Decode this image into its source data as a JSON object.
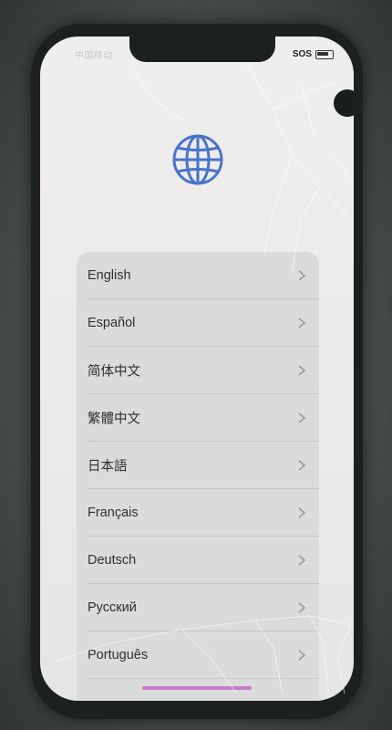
{
  "status_bar": {
    "carrier": "中国移动",
    "sos_label": "SOS"
  },
  "header": {
    "icon": "globe-icon",
    "accent_color": "#4a74c9"
  },
  "language_list": {
    "items": [
      {
        "label": "English"
      },
      {
        "label": "Español"
      },
      {
        "label": "简体中文"
      },
      {
        "label": "繁體中文"
      },
      {
        "label": "日本語"
      },
      {
        "label": "Français"
      },
      {
        "label": "Deutsch"
      },
      {
        "label": "Русский"
      },
      {
        "label": "Português"
      }
    ],
    "chevron_icon": "chevron-right-icon"
  },
  "home_indicator_color": "#c77acb"
}
